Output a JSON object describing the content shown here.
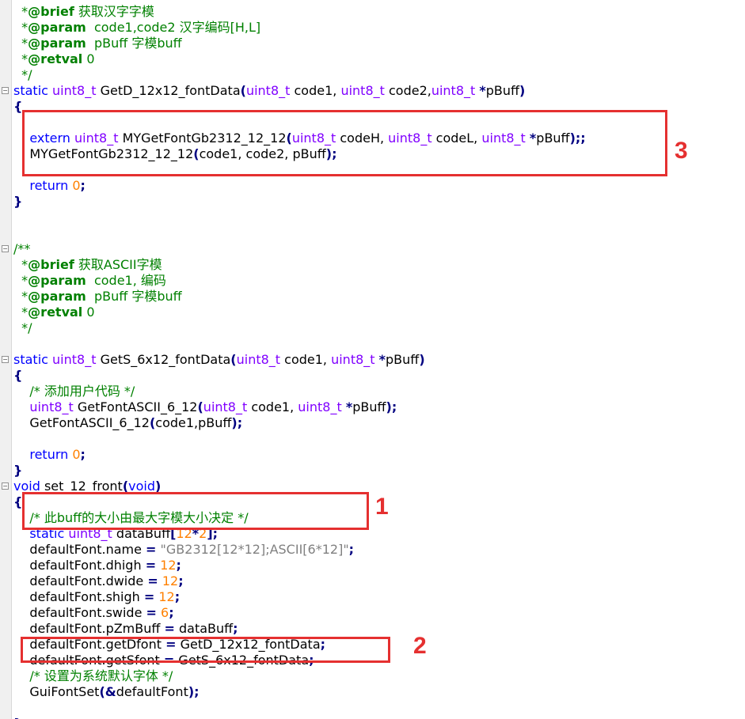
{
  "editor": {
    "lines": [
      [
        [
          "cm",
          "  *"
        ],
        [
          "dt",
          "@brief"
        ],
        [
          "cm",
          " 获取汉字字模"
        ]
      ],
      [
        [
          "cm",
          "  *"
        ],
        [
          "dt",
          "@param"
        ],
        [
          "cm",
          "  code1,code2 汉字编码[H,L]"
        ]
      ],
      [
        [
          "cm",
          "  *"
        ],
        [
          "dt",
          "@param"
        ],
        [
          "cm",
          "  pBuff 字模buff"
        ]
      ],
      [
        [
          "cm",
          "  *"
        ],
        [
          "dt",
          "@retval"
        ],
        [
          "cm",
          " 0"
        ]
      ],
      [
        [
          "cm",
          "  */"
        ]
      ],
      [
        [
          "kw",
          "static"
        ],
        [
          "id",
          " "
        ],
        [
          "ty",
          "uint8_t"
        ],
        [
          "id",
          " GetD_12x12_fontData"
        ],
        [
          "op",
          "("
        ],
        [
          "ty",
          "uint8_t"
        ],
        [
          "id",
          " code1, "
        ],
        [
          "ty",
          "uint8_t"
        ],
        [
          "id",
          " code2,"
        ],
        [
          "ty",
          "uint8_t"
        ],
        [
          "id",
          " "
        ],
        [
          "op",
          "*"
        ],
        [
          "id",
          "pBuff"
        ],
        [
          "op",
          ")"
        ]
      ],
      [
        [
          "op",
          "{"
        ]
      ],
      [],
      [
        [
          "id",
          "    "
        ],
        [
          "kw",
          "extern"
        ],
        [
          "id",
          " "
        ],
        [
          "ty",
          "uint8_t"
        ],
        [
          "id",
          " MYGetFontGb2312_12_12"
        ],
        [
          "op",
          "("
        ],
        [
          "ty",
          "uint8_t"
        ],
        [
          "id",
          " codeH, "
        ],
        [
          "ty",
          "uint8_t"
        ],
        [
          "id",
          " codeL, "
        ],
        [
          "ty",
          "uint8_t"
        ],
        [
          "id",
          " "
        ],
        [
          "op",
          "*"
        ],
        [
          "id",
          "pBuff"
        ],
        [
          "op",
          ");;"
        ]
      ],
      [
        [
          "id",
          "    MYGetFontGb2312_12_12"
        ],
        [
          "op",
          "("
        ],
        [
          "id",
          "code1, code2, pBuff"
        ],
        [
          "op",
          ");"
        ]
      ],
      [],
      [
        [
          "id",
          "    "
        ],
        [
          "kw",
          "return"
        ],
        [
          "id",
          " "
        ],
        [
          "num",
          "0"
        ],
        [
          "op",
          ";"
        ]
      ],
      [
        [
          "op",
          "}"
        ]
      ],
      [],
      [],
      [
        [
          "cm",
          "/**"
        ]
      ],
      [
        [
          "cm",
          "  *"
        ],
        [
          "dt",
          "@brief"
        ],
        [
          "cm",
          " 获取ASCII字模"
        ]
      ],
      [
        [
          "cm",
          "  *"
        ],
        [
          "dt",
          "@param"
        ],
        [
          "cm",
          "  code1, 编码"
        ]
      ],
      [
        [
          "cm",
          "  *"
        ],
        [
          "dt",
          "@param"
        ],
        [
          "cm",
          "  pBuff 字模buff"
        ]
      ],
      [
        [
          "cm",
          "  *"
        ],
        [
          "dt",
          "@retval"
        ],
        [
          "cm",
          " 0"
        ]
      ],
      [
        [
          "cm",
          "  */"
        ]
      ],
      [],
      [
        [
          "kw",
          "static"
        ],
        [
          "id",
          " "
        ],
        [
          "ty",
          "uint8_t"
        ],
        [
          "id",
          " GetS_6x12_fontData"
        ],
        [
          "op",
          "("
        ],
        [
          "ty",
          "uint8_t"
        ],
        [
          "id",
          " code1, "
        ],
        [
          "ty",
          "uint8_t"
        ],
        [
          "id",
          " "
        ],
        [
          "op",
          "*"
        ],
        [
          "id",
          "pBuff"
        ],
        [
          "op",
          ")"
        ]
      ],
      [
        [
          "op",
          "{"
        ]
      ],
      [
        [
          "id",
          "    "
        ],
        [
          "cm",
          "/* 添加用户代码 */"
        ]
      ],
      [
        [
          "id",
          "    "
        ],
        [
          "ty",
          "uint8_t"
        ],
        [
          "id",
          " GetFontASCII_6_12"
        ],
        [
          "op",
          "("
        ],
        [
          "ty",
          "uint8_t"
        ],
        [
          "id",
          " code1, "
        ],
        [
          "ty",
          "uint8_t"
        ],
        [
          "id",
          " "
        ],
        [
          "op",
          "*"
        ],
        [
          "id",
          "pBuff"
        ],
        [
          "op",
          ");"
        ]
      ],
      [
        [
          "id",
          "    GetFontASCII_6_12"
        ],
        [
          "op",
          "("
        ],
        [
          "id",
          "code1,pBuff"
        ],
        [
          "op",
          ");"
        ]
      ],
      [],
      [
        [
          "id",
          "    "
        ],
        [
          "kw",
          "return"
        ],
        [
          "id",
          " "
        ],
        [
          "num",
          "0"
        ],
        [
          "op",
          ";"
        ]
      ],
      [
        [
          "op",
          "}"
        ]
      ],
      [
        [
          "kw",
          "void"
        ],
        [
          "id",
          " set_12_front"
        ],
        [
          "op",
          "("
        ],
        [
          "kw",
          "void"
        ],
        [
          "op",
          ")"
        ]
      ],
      [
        [
          "op",
          "{"
        ]
      ],
      [
        [
          "id",
          "    "
        ],
        [
          "cm",
          "/* 此buff的大小由最大字模大小决定 */"
        ]
      ],
      [
        [
          "id",
          "    "
        ],
        [
          "kw",
          "static"
        ],
        [
          "id",
          " "
        ],
        [
          "ty",
          "uint8_t"
        ],
        [
          "id",
          " dataBuff"
        ],
        [
          "op",
          "["
        ],
        [
          "num",
          "12"
        ],
        [
          "op",
          "*"
        ],
        [
          "num",
          "2"
        ],
        [
          "op",
          "];"
        ]
      ],
      [
        [
          "id",
          "    defaultFont.name "
        ],
        [
          "op",
          "="
        ],
        [
          "id",
          " "
        ],
        [
          "str",
          "\"GB2312[12*12];ASCII[6*12]\""
        ],
        [
          "op",
          ";"
        ]
      ],
      [
        [
          "id",
          "    defaultFont.dhigh "
        ],
        [
          "op",
          "="
        ],
        [
          "id",
          " "
        ],
        [
          "num",
          "12"
        ],
        [
          "op",
          ";"
        ]
      ],
      [
        [
          "id",
          "    defaultFont.dwide "
        ],
        [
          "op",
          "="
        ],
        [
          "id",
          " "
        ],
        [
          "num",
          "12"
        ],
        [
          "op",
          ";"
        ]
      ],
      [
        [
          "id",
          "    defaultFont.shigh "
        ],
        [
          "op",
          "="
        ],
        [
          "id",
          " "
        ],
        [
          "num",
          "12"
        ],
        [
          "op",
          ";"
        ]
      ],
      [
        [
          "id",
          "    defaultFont.swide "
        ],
        [
          "op",
          "="
        ],
        [
          "id",
          " "
        ],
        [
          "num",
          "6"
        ],
        [
          "op",
          ";"
        ]
      ],
      [
        [
          "id",
          "    defaultFont.pZmBuff "
        ],
        [
          "op",
          "="
        ],
        [
          "id",
          " dataBuff"
        ],
        [
          "op",
          ";"
        ]
      ],
      [
        [
          "id",
          "    defaultFont.getDfont "
        ],
        [
          "op",
          "="
        ],
        [
          "id",
          " GetD_12x12_fontData"
        ],
        [
          "op",
          ";"
        ]
      ],
      [
        [
          "id",
          "    defaultFont.getSfont "
        ],
        [
          "op",
          "="
        ],
        [
          "id",
          " GetS_6x12_fontData"
        ],
        [
          "op",
          ";"
        ]
      ],
      [
        [
          "id",
          "    "
        ],
        [
          "cm",
          "/* 设置为系统默认字体 */"
        ]
      ],
      [
        [
          "id",
          "    GuiFontSet"
        ],
        [
          "op",
          "("
        ],
        [
          "op",
          "&"
        ],
        [
          "id",
          "defaultFont"
        ],
        [
          "op",
          ");"
        ]
      ],
      [],
      [
        [
          "op",
          "}"
        ]
      ]
    ],
    "fold_markers": [
      5,
      15,
      22,
      30
    ],
    "annotations": [
      {
        "label": "3"
      },
      {
        "label": "1"
      },
      {
        "label": "2"
      }
    ]
  },
  "colors": {
    "comment": "#008000",
    "doc_tag": "#008000",
    "keyword": "#0000ff",
    "type": "#8000ff",
    "number": "#ff8000",
    "string": "#808080",
    "operator": "#000080",
    "highlight": "#e53030"
  }
}
